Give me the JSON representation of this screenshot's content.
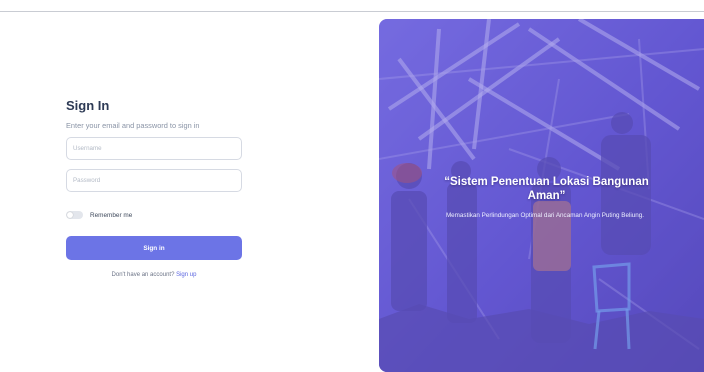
{
  "form": {
    "title": "Sign In",
    "subtitle": "Enter your email and password to sign in",
    "username_placeholder": "Username",
    "password_placeholder": "Password",
    "remember_label": "Remember me",
    "remember_checked": false,
    "signin_label": "Sign in",
    "signup_prompt": "Don't have an account?",
    "signup_link": "Sign up",
    "accent_color": "#6c74e6"
  },
  "hero": {
    "title": "“Sistem Penentuan Lokasi Bangunan Aman”",
    "subtitle": "Memastikan Perlindungan Optimal dari Ancaman Angin Puting Beliung.",
    "overlay_color": "#6d63e0"
  }
}
